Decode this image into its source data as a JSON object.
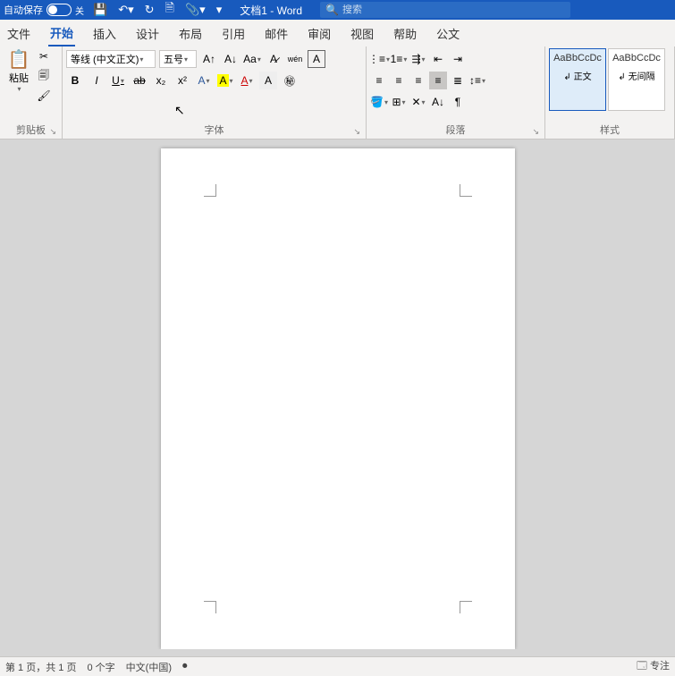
{
  "titlebar": {
    "autosave": "自动保存",
    "toggle_off": "关",
    "doc_title": "文档1",
    "app_name": "Word",
    "search_placeholder": "搜索"
  },
  "tabs": {
    "file": "文件",
    "home": "开始",
    "insert": "插入",
    "design": "设计",
    "layout": "布局",
    "references": "引用",
    "mailings": "邮件",
    "review": "审阅",
    "view": "视图",
    "help": "帮助",
    "office": "公文"
  },
  "clipboard": {
    "paste": "粘贴",
    "label": "剪贴板"
  },
  "font": {
    "font_name": "等线 (中文正文)",
    "font_size": "五号",
    "change_case": "Aa",
    "phonetic": "wén",
    "char_border": "A",
    "bold": "B",
    "italic": "I",
    "underline": "U",
    "strike": "ab",
    "sub": "x₂",
    "sup": "x²",
    "effects": "A",
    "highlight": "A",
    "color": "A",
    "shading": "A",
    "enclose": "㊙",
    "label": "字体"
  },
  "paragraph": {
    "label": "段落"
  },
  "styles": {
    "preview": "AaBbCcDc",
    "normal": "正文",
    "nospacing": "无间隔",
    "label": "样式"
  },
  "statusbar": {
    "page": "第 1 页，共 1 页",
    "words": "0 个字",
    "lang": "中文(中国)",
    "focus": "专注"
  }
}
